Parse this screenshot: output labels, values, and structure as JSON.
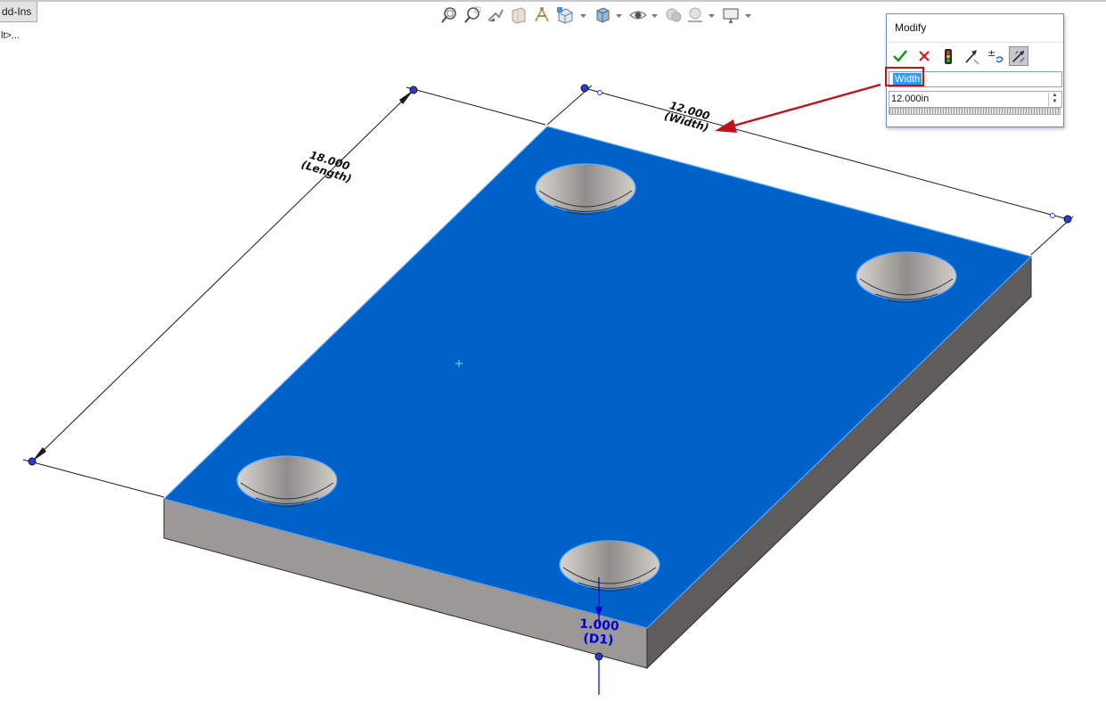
{
  "app": {
    "tab_addins": "dd-Ins",
    "tree_fragment": "lt>..."
  },
  "toolbar": {
    "icons": [
      "zoom-to-fit-icon",
      "zoom-to-area-icon",
      "previous-view-icon",
      "section-view-icon",
      "dynamic-annotation-icon",
      "view-orientation-icon",
      "display-style-icon",
      "hide-show-items-icon",
      "edit-appearance-icon",
      "apply-scene-icon",
      "view-settings-icon"
    ]
  },
  "modify_dialog": {
    "title": "Modify",
    "dimension_name": "Width",
    "dimension_value": "12.000in",
    "buttons": [
      "ok-check-icon",
      "cancel-x-icon",
      "rebuild-icon",
      "reverse-dimension-icon",
      "mark-for-drawing-icon",
      "regenerate-options-icon"
    ]
  },
  "dimensions": {
    "length": {
      "value": "18.000",
      "name": "(Length)"
    },
    "width": {
      "value": "12.000",
      "name": "(Width)"
    },
    "thickness": {
      "value": "1.000",
      "name": "(D1)"
    }
  },
  "colors": {
    "selected_face": "#0062c9",
    "face_edge": "#5aa8ff",
    "side_face": "#9b9896",
    "dimension_blue": "#0000d0",
    "callout_red": "#c0121a"
  }
}
